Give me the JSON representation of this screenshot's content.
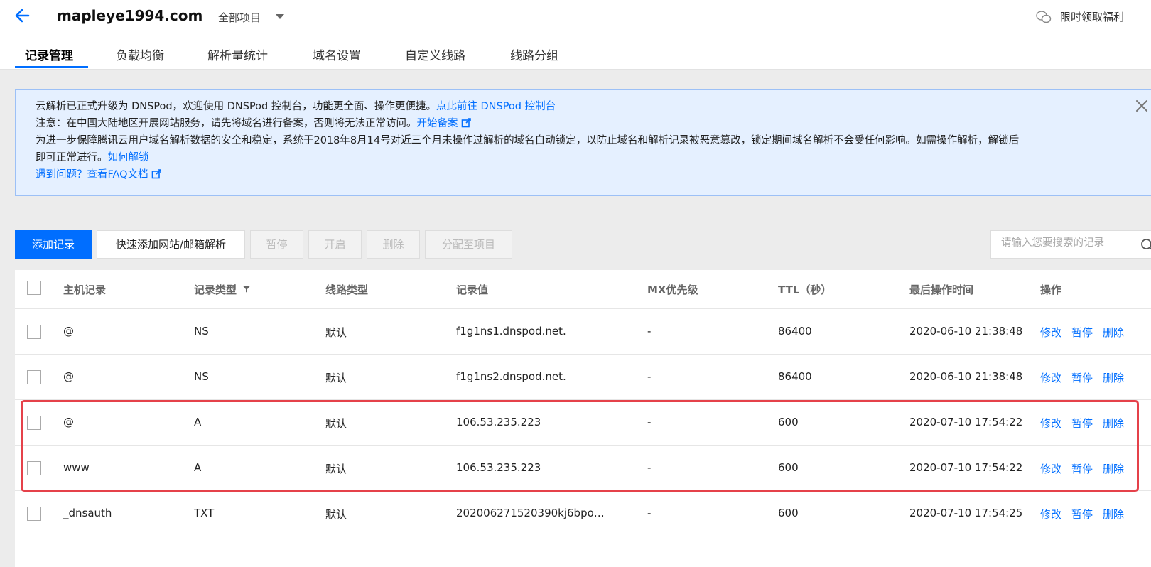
{
  "header": {
    "domain": "mapleye1994.com",
    "project": "全部项目",
    "promo": "限时领取福利"
  },
  "tabs": [
    {
      "label": "记录管理",
      "active": true
    },
    {
      "label": "负载均衡"
    },
    {
      "label": "解析量统计"
    },
    {
      "label": "域名设置"
    },
    {
      "label": "自定义线路"
    },
    {
      "label": "线路分组"
    }
  ],
  "notice": {
    "line1": "云解析已正式升级为 DNSPod，欢迎使用 DNSPod 控制台，功能更全面、操作更便捷。",
    "line1_link": "点此前往 DNSPod 控制台",
    "line2": "注意：在中国大陆地区开展网站服务，请先将域名进行备案，否则将无法正常访问。",
    "line2_link": "开始备案",
    "line3": "为进一步保障腾讯云用户域名解析数据的安全和稳定，系统于2018年8月14号对近三个月未操作过解析的域名自动锁定，以防止域名和解析记录被恶意篡改，锁定期间域名解析不会受任何影响。如需操作解析，解锁后",
    "line4": "即可正常进行。",
    "line4_link": "如何解锁",
    "line5_link": "遇到问题？查看FAQ文档"
  },
  "toolbar": {
    "add": "添加记录",
    "quick_add": "快速添加网站/邮箱解析",
    "pause": "暂停",
    "enable": "开启",
    "delete": "删除",
    "assign": "分配至项目",
    "search_placeholder": "请输入您要搜索的记录"
  },
  "table": {
    "columns": [
      "主机记录",
      "记录类型",
      "线路类型",
      "记录值",
      "MX优先级",
      "TTL（秒）",
      "最后操作时间",
      "操作"
    ],
    "actions": [
      "修改",
      "暂停",
      "删除"
    ],
    "rows": [
      {
        "host": "@",
        "type": "NS",
        "line": "默认",
        "value": "f1g1ns1.dnspod.net.",
        "mx": "-",
        "ttl": "86400",
        "time": "2020-06-10 21:38:48"
      },
      {
        "host": "@",
        "type": "NS",
        "line": "默认",
        "value": "f1g1ns2.dnspod.net.",
        "mx": "-",
        "ttl": "86400",
        "time": "2020-06-10 21:38:48"
      },
      {
        "host": "@",
        "type": "A",
        "line": "默认",
        "value": "106.53.235.223",
        "mx": "-",
        "ttl": "600",
        "time": "2020-07-10 17:54:22"
      },
      {
        "host": "www",
        "type": "A",
        "line": "默认",
        "value": "106.53.235.223",
        "mx": "-",
        "ttl": "600",
        "time": "2020-07-10 17:54:22"
      },
      {
        "host": "_dnsauth",
        "type": "TXT",
        "line": "默认",
        "value": "202006271520390kj6bpo…",
        "mx": "-",
        "ttl": "600",
        "time": "2020-07-10 17:54:25"
      }
    ]
  },
  "colors": {
    "accent": "#006eff",
    "highlight": "#e5414a"
  }
}
